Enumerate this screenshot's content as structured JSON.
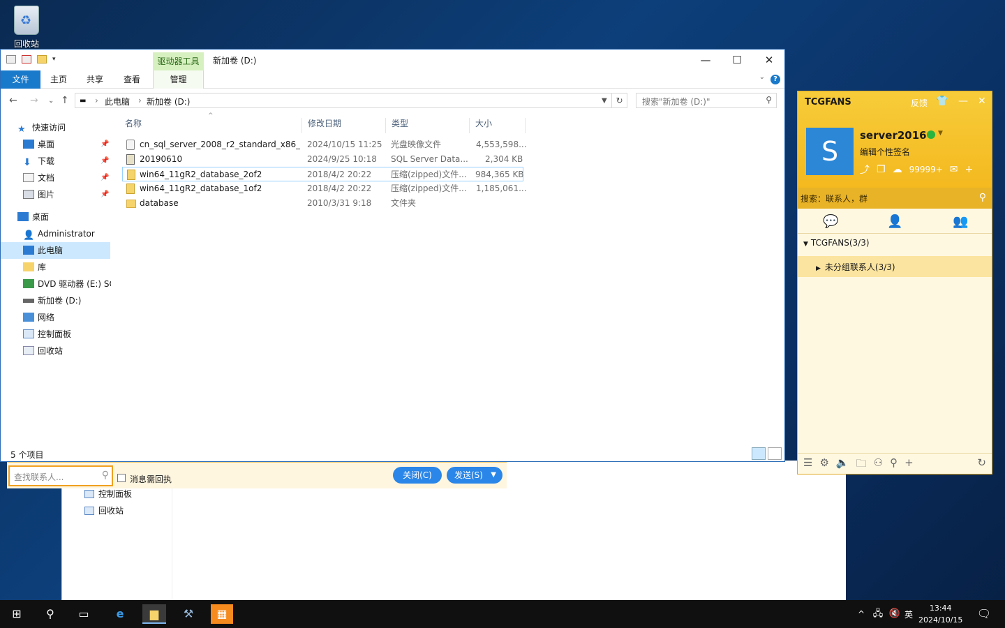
{
  "desktop": {
    "recycle_bin_label": "回收站"
  },
  "explorer": {
    "drive_tools_tab": "驱动器工具",
    "window_title": "新加卷 (D:)",
    "ribbon_tabs": {
      "file": "文件",
      "home": "主页",
      "share": "共享",
      "view": "查看",
      "manage": "管理"
    },
    "address": {
      "crumb1": "此电脑",
      "crumb2": "新加卷 (D:)"
    },
    "search_placeholder": "搜索\"新加卷 (D:)\"",
    "nav": {
      "quick_access": "快速访问",
      "desktop_pinned": "桌面",
      "downloads": "下载",
      "documents": "文档",
      "pictures": "图片",
      "desktop": "桌面",
      "administrator": "Administrator",
      "this_pc": "此电脑",
      "libraries": "库",
      "dvd": "DVD 驱动器 (E:) SC",
      "volume_d": "新加卷 (D:)",
      "network": "网络",
      "control_panel": "控制面板",
      "recycle_bin": "回收站"
    },
    "columns": {
      "name": "名称",
      "date": "修改日期",
      "type": "类型",
      "size": "大小"
    },
    "files": [
      {
        "name": "cn_sql_server_2008_r2_standard_x86_...",
        "date": "2024/10/15 11:25",
        "type": "光盘映像文件",
        "size": "4,553,598..."
      },
      {
        "name": "20190610",
        "date": "2024/9/25 10:18",
        "type": "SQL Server Data...",
        "size": "2,304 KB"
      },
      {
        "name": "win64_11gR2_database_2of2",
        "date": "2018/4/2 20:22",
        "type": "压缩(zipped)文件...",
        "size": "984,365 KB"
      },
      {
        "name": "win64_11gR2_database_1of2",
        "date": "2018/4/2 20:22",
        "type": "压缩(zipped)文件...",
        "size": "1,185,061..."
      },
      {
        "name": "database",
        "date": "2010/3/31 9:18",
        "type": "文件夹",
        "size": ""
      }
    ],
    "status_count": "5 个项目"
  },
  "bg_window": {
    "control_panel": "控制面板",
    "recycle_bin": "回收站"
  },
  "chat_strip": {
    "contact_search_placeholder": "查找联系人...",
    "receipt_label": "消息需回执",
    "close_button": "关闭(C)",
    "send_button": "发送(S)"
  },
  "qq": {
    "brand": "TCGFANS",
    "feedback": "反馈",
    "avatar_letter": "S",
    "nickname": "server2016",
    "signature": "编辑个性签名",
    "mail_count": "99999+",
    "search_placeholder": "搜索：联系人，群",
    "group": "TCGFANS(3/3)",
    "subgroup": "未分组联系人(3/3)"
  },
  "taskbar": {
    "time": "13:44",
    "date": "2024/10/15",
    "lang": "英"
  }
}
